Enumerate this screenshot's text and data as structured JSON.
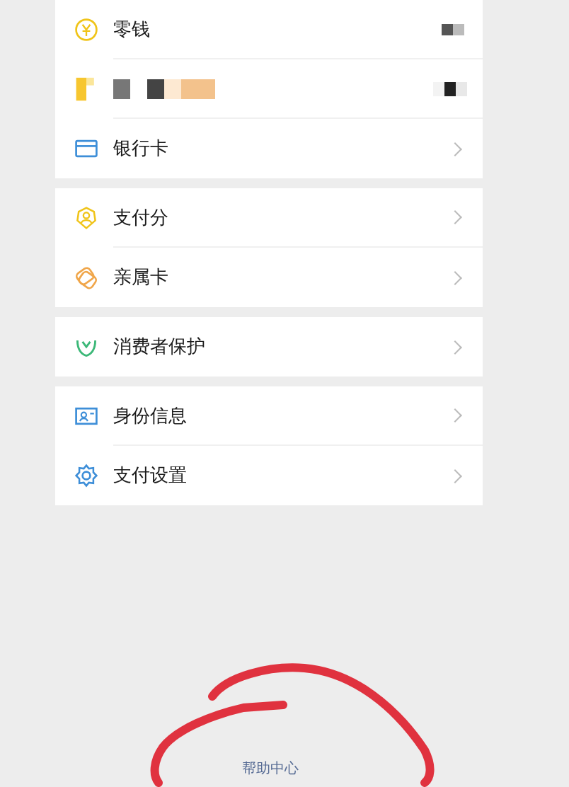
{
  "groups": [
    {
      "rows": [
        {
          "kind": "balance",
          "label": "零钱"
        },
        {
          "kind": "redacted"
        },
        {
          "kind": "link",
          "label": "银行卡"
        }
      ]
    },
    {
      "rows": [
        {
          "kind": "link",
          "label": "支付分"
        },
        {
          "kind": "link",
          "label": "亲属卡"
        }
      ]
    },
    {
      "rows": [
        {
          "kind": "link",
          "label": "消费者保护"
        }
      ]
    },
    {
      "rows": [
        {
          "kind": "link",
          "label": "身份信息"
        },
        {
          "kind": "link",
          "label": "支付设置"
        }
      ]
    }
  ],
  "footer": {
    "link": "帮助中心"
  }
}
